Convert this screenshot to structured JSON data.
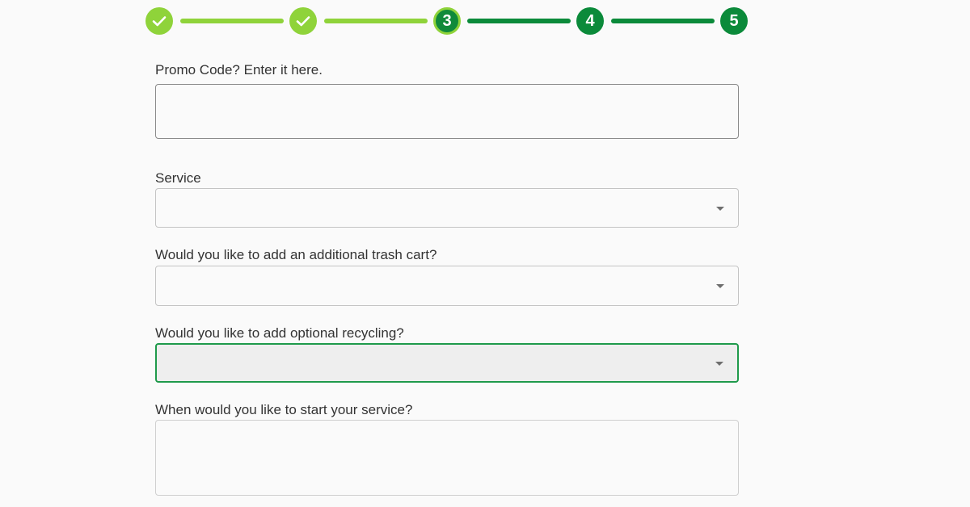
{
  "stepper": {
    "steps": [
      {
        "label": "",
        "status": "completed",
        "icon": "check-icon"
      },
      {
        "label": "",
        "status": "completed",
        "icon": "check-icon"
      },
      {
        "label": "3",
        "status": "current"
      },
      {
        "label": "4",
        "status": "upcoming"
      },
      {
        "label": "5",
        "status": "upcoming"
      }
    ],
    "colors": {
      "completed": "#8fd33a",
      "current": "#108a3a",
      "upcoming": "#0b8a3a"
    }
  },
  "form": {
    "promo_code": {
      "label": "Promo Code? Enter it here.",
      "value": ""
    },
    "service": {
      "label": "Service",
      "value": ""
    },
    "additional_cart": {
      "label": "Would you like to add an additional trash cart?",
      "value": ""
    },
    "recycling": {
      "label": "Would you like to add optional recycling?",
      "value": "",
      "focused": true
    },
    "start_service": {
      "label": "When would you like to start your service?",
      "value": ""
    }
  },
  "accent_color": "#1f9a4b"
}
